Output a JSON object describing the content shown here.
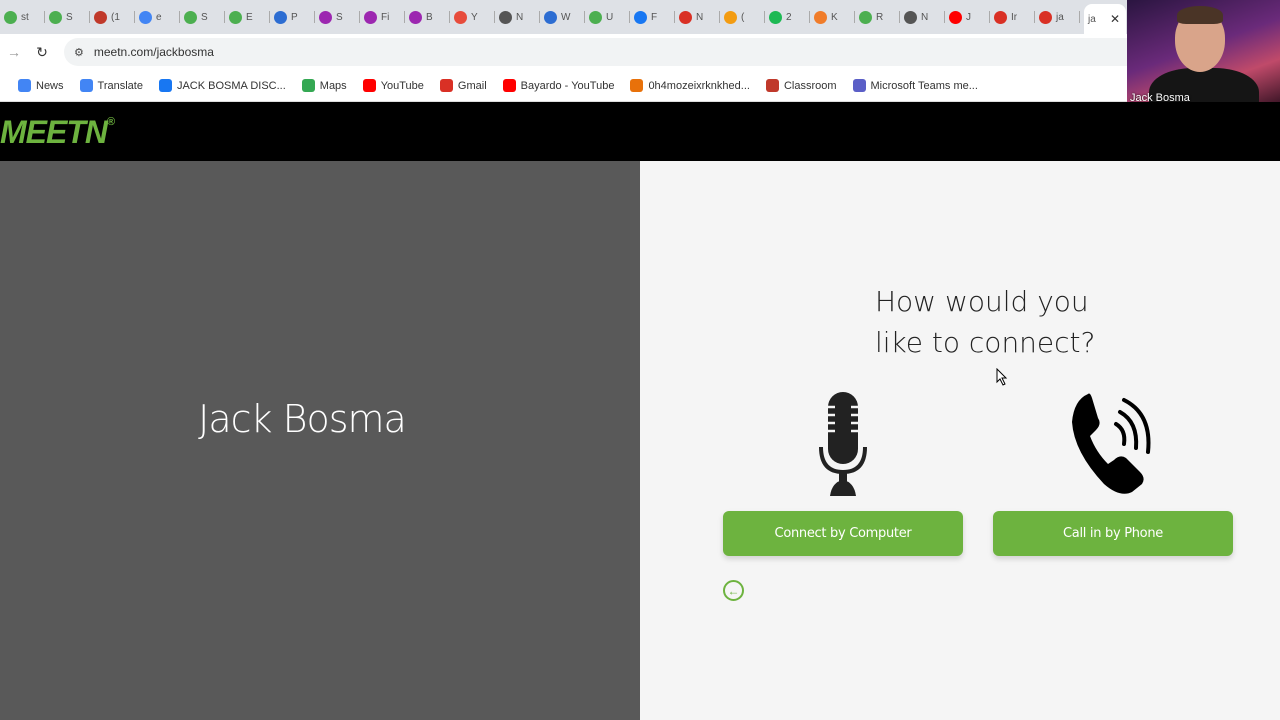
{
  "browser": {
    "tabs": [
      {
        "label": "st",
        "color": "#4caf50"
      },
      {
        "label": "S",
        "color": "#4caf50"
      },
      {
        "label": "(1",
        "color": "#c0392b"
      },
      {
        "label": "e",
        "color": "#4285f4"
      },
      {
        "label": "S",
        "color": "#4caf50"
      },
      {
        "label": "E",
        "color": "#4caf50"
      },
      {
        "label": "P",
        "color": "#2d6dd2"
      },
      {
        "label": "S",
        "color": "#9c27b0"
      },
      {
        "label": "Fi",
        "color": "#9c27b0"
      },
      {
        "label": "B",
        "color": "#9c27b0"
      },
      {
        "label": "Y",
        "color": "#e74c3c"
      },
      {
        "label": "N",
        "color": "#555555"
      },
      {
        "label": "W",
        "color": "#2d6dd2"
      },
      {
        "label": "U",
        "color": "#4caf50"
      },
      {
        "label": "F",
        "color": "#1877f2"
      },
      {
        "label": "N",
        "color": "#d93025"
      },
      {
        "label": "(",
        "color": "#f39c12"
      },
      {
        "label": "2",
        "color": "#1db954"
      },
      {
        "label": "K",
        "color": "#f07c2a"
      },
      {
        "label": "R",
        "color": "#4caf50"
      },
      {
        "label": "N",
        "color": "#555555"
      },
      {
        "label": "J",
        "color": "#ff0000"
      },
      {
        "label": "Ir",
        "color": "#d93025"
      },
      {
        "label": "ja",
        "color": "#d93025"
      }
    ],
    "active_tab": {
      "label": "ja",
      "close": "✕"
    },
    "url": "meetn.com/jackbosma",
    "bookmarks": [
      {
        "label": "News",
        "color": "#4285f4"
      },
      {
        "label": "Translate",
        "color": "#4285f4"
      },
      {
        "label": "JACK BOSMA DISC...",
        "color": "#1877f2"
      },
      {
        "label": "Maps",
        "color": "#34a853"
      },
      {
        "label": "YouTube",
        "color": "#ff0000"
      },
      {
        "label": "Gmail",
        "color": "#d93025"
      },
      {
        "label": "Bayardo - YouTube",
        "color": "#ff0000"
      },
      {
        "label": "0h4mozeixrknkhed...",
        "color": "#e8710a"
      },
      {
        "label": "Classroom",
        "color": "#c0392b"
      },
      {
        "label": "Microsoft Teams me...",
        "color": "#5b5fc7"
      }
    ]
  },
  "webcam": {
    "name": "Jack Bosma"
  },
  "app": {
    "logo": "MEETN",
    "logo_mark": "®",
    "brand_color": "#6db33f",
    "host_name": "Jack Bosma",
    "question_line1": "How would you",
    "question_line2": "like to connect?",
    "options": [
      {
        "icon": "microphone-icon",
        "label": "Connect by Computer"
      },
      {
        "icon": "phone-icon",
        "label": "Call in by Phone"
      }
    ],
    "back_icon": "arrow-left-circle-icon"
  }
}
